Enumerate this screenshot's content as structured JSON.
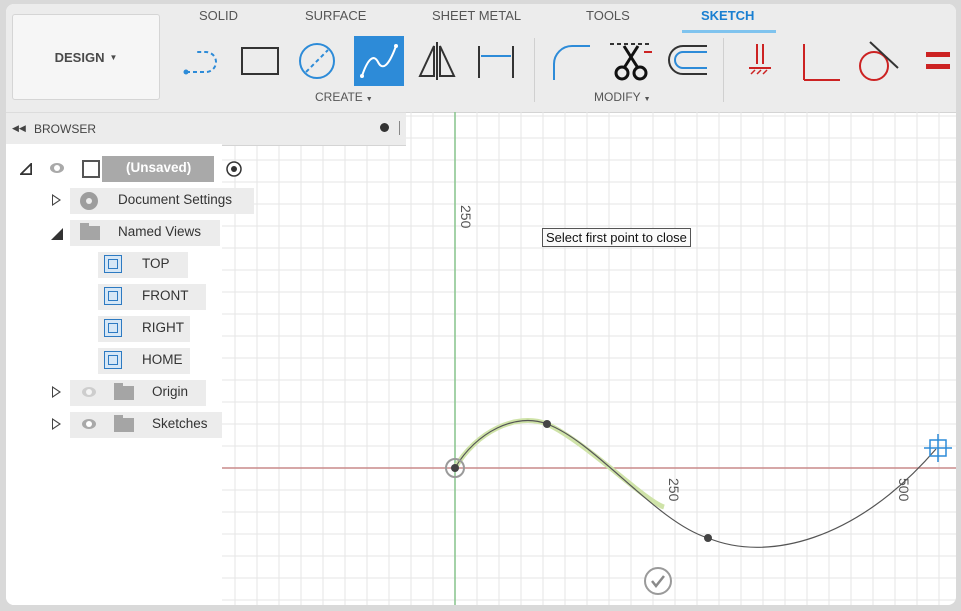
{
  "toolbar": {
    "workspace_button": "DESIGN",
    "tabs": [
      "SOLID",
      "SURFACE",
      "SHEET METAL",
      "TOOLS",
      "SKETCH"
    ],
    "active_tab": "SKETCH",
    "groups": {
      "create": "CREATE",
      "modify": "MODIFY"
    },
    "create_tools": [
      "center-point-arc-icon",
      "rectangle-icon",
      "circle-icon",
      "spline-icon",
      "mirror-icon",
      "dimension-icon"
    ],
    "active_tool": "spline-icon",
    "modify_tools": [
      "fillet-icon",
      "trim-icon",
      "offset-icon"
    ],
    "constraint_tools": [
      "parallel-constraint-icon",
      "perpendicular-constraint-icon",
      "tangent-constraint-icon",
      "equal-constraint-icon"
    ]
  },
  "browser": {
    "title": "BROWSER",
    "root": {
      "label": "(Unsaved)"
    },
    "items": [
      {
        "label": "Document Settings"
      },
      {
        "label": "Named Views"
      },
      {
        "label": "TOP"
      },
      {
        "label": "FRONT"
      },
      {
        "label": "RIGHT"
      },
      {
        "label": "HOME"
      },
      {
        "label": "Origin"
      },
      {
        "label": "Sketches"
      }
    ]
  },
  "canvas": {
    "axis_labels": [
      "250",
      "250",
      "500"
    ],
    "tooltip": "Select first point to close",
    "colors": {
      "grid": "#e6e6e6",
      "y_axis": "#86c48b",
      "x_axis": "#c98a8a",
      "spline": "#555555",
      "highlight": "#cfe3a8",
      "accent": "#2d8bd8"
    }
  }
}
